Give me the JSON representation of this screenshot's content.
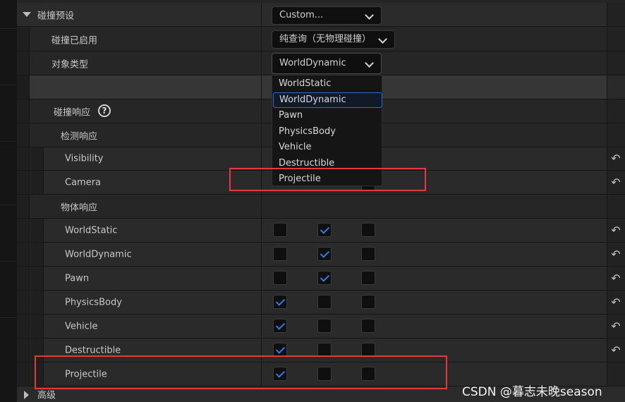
{
  "presets": {
    "collision_presets_label": "碰撞预设",
    "collision_presets_value": "Custom...",
    "collision_enabled_label": "碰撞已启用",
    "collision_enabled_value": "纯查询（无物理碰撞）",
    "object_type_label": "对象类型",
    "object_type_value": "WorldDynamic"
  },
  "object_type_options": [
    "WorldStatic",
    "WorldDynamic",
    "Pawn",
    "PhysicsBody",
    "Vehicle",
    "Destructible",
    "Projectile"
  ],
  "object_type_selected": "WorldDynamic",
  "responses": {
    "collision_responses_label": "碰撞响应",
    "help_glyph": "?",
    "trace_responses_label": "检测响应",
    "trace_rows": [
      {
        "name": "Visibility"
      },
      {
        "name": "Camera"
      }
    ],
    "object_responses_label": "物体响应",
    "object_rows": [
      {
        "name": "WorldStatic",
        "ignore": false,
        "overlap": true,
        "block": false
      },
      {
        "name": "WorldDynamic",
        "ignore": false,
        "overlap": true,
        "block": false
      },
      {
        "name": "Pawn",
        "ignore": false,
        "overlap": true,
        "block": false
      },
      {
        "name": "PhysicsBody",
        "ignore": true,
        "overlap": false,
        "block": false
      },
      {
        "name": "Vehicle",
        "ignore": true,
        "overlap": false,
        "block": false
      },
      {
        "name": "Destructible",
        "ignore": true,
        "overlap": false,
        "block": false
      },
      {
        "name": "Projectile",
        "ignore": true,
        "overlap": false,
        "block": false
      }
    ]
  },
  "advanced_label": "高级",
  "reset_glyph": "↶",
  "watermark": "CSDN @暮志未晚season",
  "colors": {
    "check_blue": "#2f7ae5",
    "highlight_red": "#e0393e",
    "selection_border": "#2d6ad1"
  }
}
